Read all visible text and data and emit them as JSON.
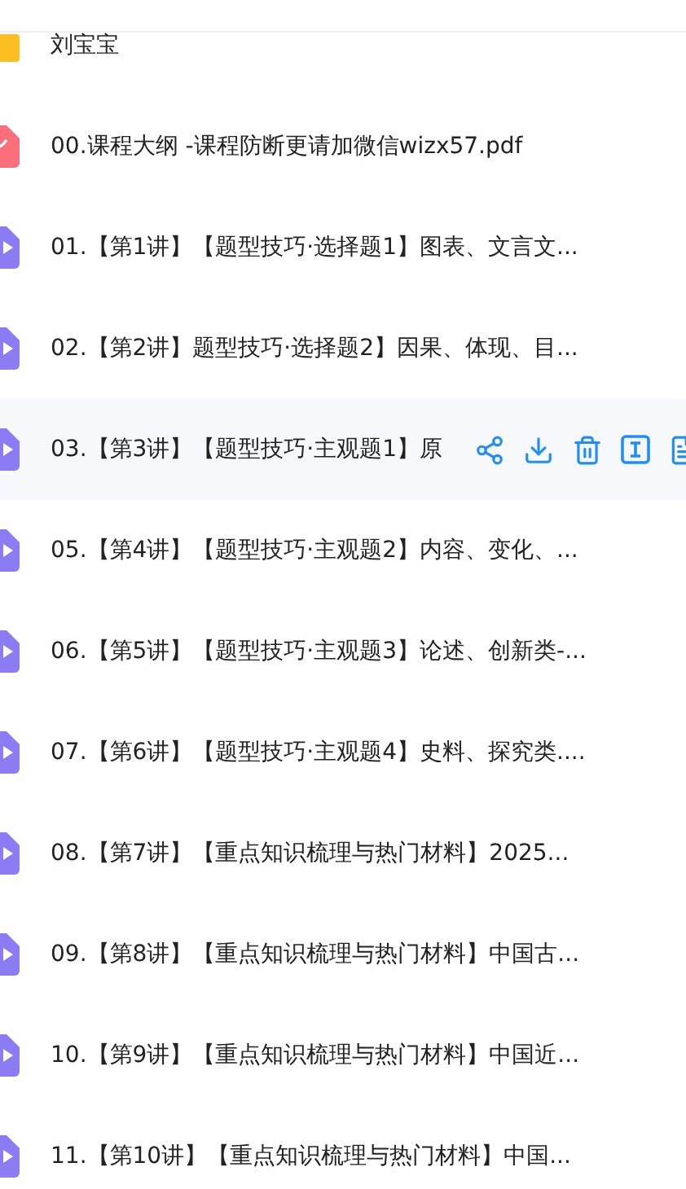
{
  "files": [
    {
      "kind": "folder",
      "name": "刘宝宝",
      "hovered": false
    },
    {
      "kind": "pdf",
      "name": "00.课程大纲 -课程防断更请加微信wizx57.pdf",
      "hovered": false
    },
    {
      "kind": "video",
      "name": "01.【第1讲】【题型技巧·选择题1】图表、文言文...",
      "hovered": false
    },
    {
      "kind": "video",
      "name": "02.【第2讲】题型技巧·选择题2】因果、体现、目...",
      "hovered": false
    },
    {
      "kind": "video",
      "name": "03.【第3讲】【题型技巧·主观题1】原",
      "hovered": true
    },
    {
      "kind": "video",
      "name": "05.【第4讲】【题型技巧·主观题2】内容、变化、...",
      "hovered": false
    },
    {
      "kind": "video",
      "name": "06.【第5讲】【题型技巧·主观题3】论述、创新类-...",
      "hovered": false
    },
    {
      "kind": "video",
      "name": "07.【第6讲】【题型技巧·主观题4】史料、探究类....",
      "hovered": false
    },
    {
      "kind": "video",
      "name": "08.【第7讲】【重点知识梳理与热门材料】2025...",
      "hovered": false
    },
    {
      "kind": "video",
      "name": "09.【第8讲】【重点知识梳理与热门材料】中国古...",
      "hovered": false
    },
    {
      "kind": "video",
      "name": "10.【第9讲】【重点知识梳理与热门材料】中国近...",
      "hovered": false
    },
    {
      "kind": "video",
      "name": "11.【第10讲】【重点知识梳理与热门材料】中国...",
      "hovered": false
    }
  ]
}
